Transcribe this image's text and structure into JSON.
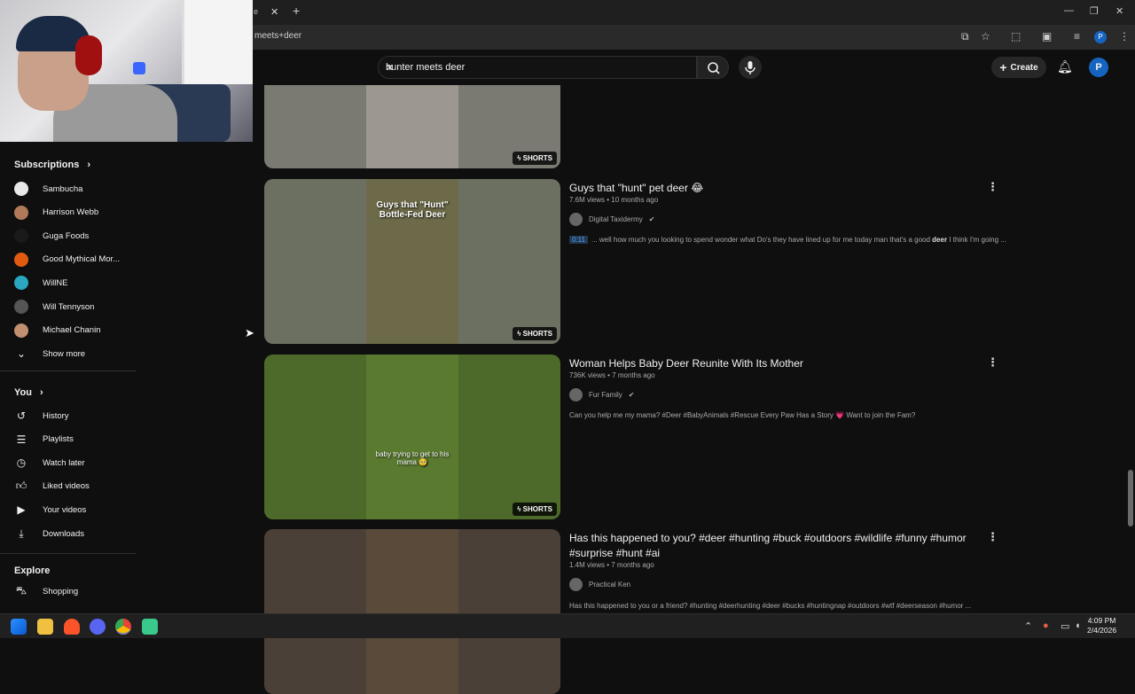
{
  "browser": {
    "tab_partial": "e",
    "url": "meets+deer",
    "tab_close": "✕",
    "new_tab": "+"
  },
  "header": {
    "search_value": "hunter meets deer",
    "create_label": "Create",
    "avatar_letter": "P"
  },
  "sidebar": {
    "subscriptions_heading": "Subscriptions",
    "subscriptions": [
      {
        "name": "Sambucha",
        "color": "#e8e8e8"
      },
      {
        "name": "Harrison Webb",
        "color": "#b07a5a"
      },
      {
        "name": "Guga Foods",
        "color": "#1a1a1a"
      },
      {
        "name": "Good Mythical Mor...",
        "color": "#e05a10"
      },
      {
        "name": "WillNE",
        "color": "#2aa6c0"
      },
      {
        "name": "Will Tennyson",
        "color": "#555555"
      },
      {
        "name": "Michael Chanin",
        "color": "#c09070"
      }
    ],
    "show_more": "Show more",
    "you_heading": "You",
    "you_items": [
      {
        "label": "History",
        "icon": "history-icon"
      },
      {
        "label": "Playlists",
        "icon": "playlists-icon"
      },
      {
        "label": "Watch later",
        "icon": "clock-icon"
      },
      {
        "label": "Liked videos",
        "icon": "thumbs-up-icon"
      },
      {
        "label": "Your videos",
        "icon": "play-square-icon"
      },
      {
        "label": "Downloads",
        "icon": "download-icon"
      }
    ],
    "explore_heading": "Explore",
    "explore_items": [
      {
        "label": "Shopping",
        "icon": "shopping-bag-icon"
      }
    ]
  },
  "results": [
    {
      "title": "",
      "shorts_label": "SHORTS",
      "thumb_bg": "#7a7a72",
      "thumb_inner": "#9c9890"
    },
    {
      "title": "Guys that \"hunt\" pet deer 😂",
      "views": "7.6M views • 10 months ago",
      "channel": "Digital Taxidermy",
      "timestamp": "0:11",
      "snippet_pre": "... well how much you looking to spend wonder what Do's they have lined up for me today man that's a good ",
      "snippet_bold": "deer",
      "snippet_post": " I think I'm going ...",
      "shorts_label": "SHORTS",
      "thumb_text": "Guys that \"Hunt\" Bottle-Fed Deer",
      "thumb_bg": "#6b7060",
      "thumb_inner": "#6c6a48"
    },
    {
      "title": "Woman Helps Baby Deer Reunite With Its Mother",
      "views": "736K views • 7 months ago",
      "channel": "Fur Family",
      "snippet": "Can you help me my mama? #Deer #BabyAnimals #Rescue Every Paw Has a Story 💗 Want to join the Fam?",
      "shorts_label": "SHORTS",
      "thumb_text": "baby trying to get to his mama 🥺",
      "thumb_bg": "#4e6a2a",
      "thumb_inner": "#5a7a30"
    },
    {
      "title": "Has this happened to you? #deer #hunting #buck #outdoors #wildlife #funny #humor #surprise #hunt #ai",
      "views": "1.4M views • 7 months ago",
      "channel": "Practical Ken",
      "snippet": "Has this happened to you or a friend? #hunting #deerhunting #deer #bucks #huntingnap #outdoors #wtf #deerseason #humor ...",
      "thumb_bg": "#4a4038",
      "thumb_inner": "#5a4a3a"
    }
  ],
  "taskbar": {
    "time": "4:09 PM",
    "date": "2/4/2026"
  }
}
